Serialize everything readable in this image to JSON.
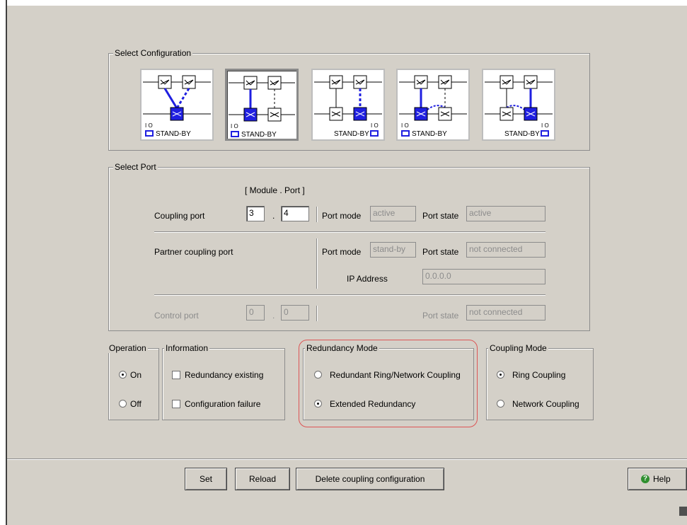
{
  "select_configuration": {
    "legend": "Select Configuration",
    "tiles": [
      {
        "caption": "STAND-BY",
        "io": "I O"
      },
      {
        "caption": "STAND-BY",
        "io": "I O"
      },
      {
        "caption": "STAND-BY",
        "io": "I O"
      },
      {
        "caption": "STAND-BY",
        "io": "I O"
      },
      {
        "caption": "STAND-BY",
        "io": "I O"
      }
    ],
    "selected_index": 1
  },
  "select_port": {
    "legend": "Select Port",
    "module_port_header": "[ Module . Port ]",
    "coupling_port": {
      "label": "Coupling port",
      "module": "3",
      "dot": ".",
      "port": "4",
      "port_mode_label": "Port mode",
      "port_mode_value": "active",
      "port_state_label": "Port state",
      "port_state_value": "active"
    },
    "partner_port": {
      "label": "Partner coupling port",
      "port_mode_label": "Port mode",
      "port_mode_value": "stand-by",
      "port_state_label": "Port state",
      "port_state_value": "not connected",
      "ip_label": "IP Address",
      "ip_value": "0.0.0.0"
    },
    "control_port": {
      "label": "Control port",
      "module": "0",
      "dot": ".",
      "port": "0",
      "port_state_label": "Port state",
      "port_state_value": "not connected"
    }
  },
  "operation": {
    "legend": "Operation",
    "on_label": "On",
    "off_label": "Off",
    "selected": "On"
  },
  "information": {
    "legend": "Information",
    "redundancy_existing": "Redundancy existing",
    "configuration_failure": "Configuration failure"
  },
  "redundancy_mode": {
    "legend": "Redundancy Mode",
    "option1": "Redundant Ring/Network Coupling",
    "option2": "Extended Redundancy",
    "selected": "Extended Redundancy",
    "highlight_color": "#dd5555"
  },
  "coupling_mode": {
    "legend": "Coupling Mode",
    "option1": "Ring Coupling",
    "option2": "Network Coupling",
    "selected": "Ring Coupling"
  },
  "buttons": {
    "set": "Set",
    "reload": "Reload",
    "delete": "Delete coupling configuration",
    "help": "Help"
  },
  "colors": {
    "background": "#d4d0c8",
    "accent_blue": "#1f1fe0"
  }
}
